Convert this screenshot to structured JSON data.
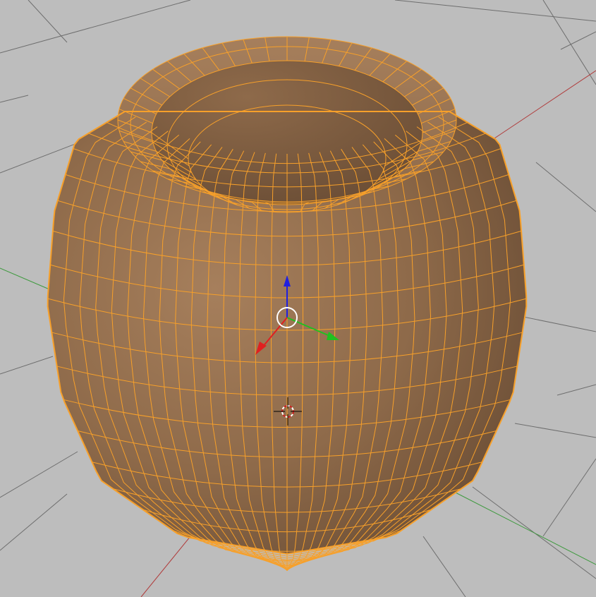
{
  "viewport": {
    "mode": "edit-mode",
    "selected_object": "selected-vase-mesh"
  },
  "colors": {
    "background": "#bdbdbd",
    "grid_line": "#6e6e6e",
    "grid_axis_x": "#b03a3a",
    "grid_axis_y": "#3e9a3e",
    "wire_selected": "#f7a02a",
    "mesh_light": "#a67f5c",
    "mesh_mid": "#8e6a4a",
    "mesh_dark": "#6a4d35",
    "gizmo_x": "#e02020",
    "gizmo_y": "#20c020",
    "gizmo_z": "#2020e0",
    "gizmo_ring": "#ffffff",
    "cursor_red": "#d02020",
    "cursor_white": "#ffffff"
  },
  "icons": {
    "manipulator": "transform-manipulator-icon",
    "cursor": "3d-cursor-icon"
  }
}
